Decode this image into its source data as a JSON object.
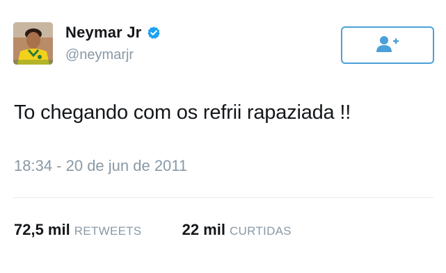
{
  "user": {
    "display_name": "Neymar Jr",
    "handle": "@neymarjr",
    "verified_icon": "verified-badge-icon",
    "avatar_icon": "avatar"
  },
  "follow_button": {
    "icon": "add-user-icon"
  },
  "tweet": {
    "text": "To chegando com os refrii rapaziada !!",
    "timestamp": "18:34 - 20 de jun de 2011"
  },
  "stats": {
    "retweets_count": "72,5 mil",
    "retweets_label": "RETWEETS",
    "likes_count": "22 mil",
    "likes_label": "CURTIDAS"
  },
  "colors": {
    "accent": "#4aa0d8",
    "verified": "#1da1f2",
    "secondary_text": "#8899a6",
    "primary_text": "#14171a",
    "divider": "#e1e8ed"
  }
}
